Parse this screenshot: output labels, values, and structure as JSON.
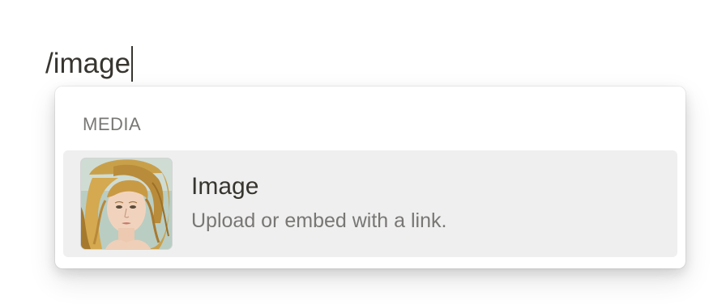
{
  "editor": {
    "typed_command": "/image"
  },
  "menu": {
    "section_label": "MEDIA",
    "items": [
      {
        "icon": "image-thumbnail-icon",
        "title": "Image",
        "description": "Upload or embed with a link."
      }
    ]
  },
  "colors": {
    "text_primary": "#37352f",
    "text_secondary": "#787774",
    "item_highlight": "#efefef",
    "menu_background": "#ffffff"
  }
}
